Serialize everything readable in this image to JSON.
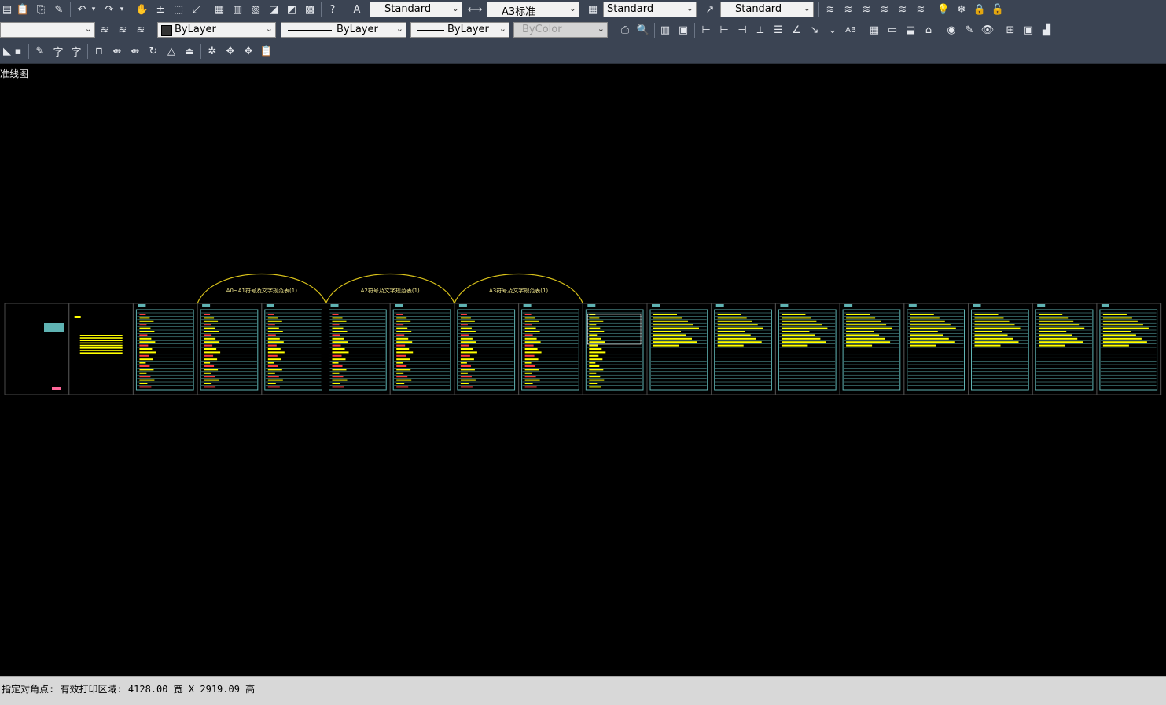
{
  "toolbar_row1": {
    "text_style": "Standard",
    "dim_style": "A3标准",
    "table_style": "Standard",
    "multileader_style": "Standard"
  },
  "toolbar_row2": {
    "layer": "",
    "color": "ByLayer",
    "linetype": "ByLayer",
    "lineweight": "ByLayer",
    "plot_style": "ByColor"
  },
  "canvas": {
    "view_label": "准线图",
    "sheet_titles": [
      "A0~A1符号及文字规范表(1)",
      "A2符号及文字规范表(1)",
      "A3符号及文字规范表(1)"
    ]
  },
  "status": {
    "command_line": "指定对角点: 有效打印区域:  4128.00 宽 X 2919.09 高"
  },
  "colors": {
    "toolbar_bg": "#3b4453",
    "canvas_bg": "#000000",
    "sheet_frame": "#5fb3b3",
    "sheet_text": "#ffff00",
    "arc": "#d9c21a",
    "status_bg": "#d8d8d8"
  }
}
